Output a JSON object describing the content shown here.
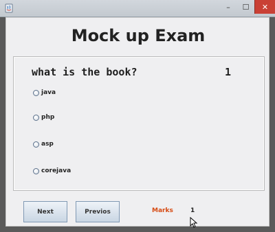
{
  "window": {
    "title_icon": "java-cup-icon",
    "controls": {
      "minimize": "–",
      "maximize": "☐",
      "close": "✕"
    },
    "colors": {
      "close_bg": "#c94035",
      "content_bg": "#efeff1"
    }
  },
  "app": {
    "title": "Mock up Exam"
  },
  "question": {
    "text": "what is the book?",
    "number": "1"
  },
  "options": [
    {
      "label": "java"
    },
    {
      "label": "php"
    },
    {
      "label": "asp"
    },
    {
      "label": "corejava"
    }
  ],
  "buttons": {
    "next": "Next",
    "previous": "Previos"
  },
  "marks": {
    "label": "Marks",
    "value": "1",
    "label_color": "#d64a12"
  }
}
